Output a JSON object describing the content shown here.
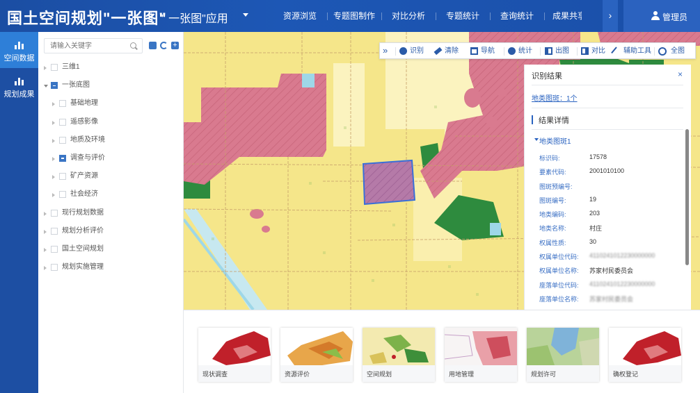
{
  "header": {
    "title": "国土空间规划\"一张图\"",
    "subtitle": "\" 一张图\"应用",
    "nav": [
      "资源浏览",
      "专题图制作",
      "对比分析",
      "专题统计",
      "查询统计",
      "成果共享"
    ],
    "user": "管理员"
  },
  "leftbar": {
    "items": [
      "空间数据",
      "规划成果"
    ]
  },
  "tree": {
    "search_placeholder": "请输入关键字",
    "rows": [
      {
        "label": "三维1",
        "level": 0,
        "state": "none"
      },
      {
        "label": "一张底图",
        "level": 0,
        "state": "partial",
        "open": true
      },
      {
        "label": "基础地理",
        "level": 1,
        "state": "none"
      },
      {
        "label": "遥感影像",
        "level": 1,
        "state": "none"
      },
      {
        "label": "地质及环境",
        "level": 1,
        "state": "none"
      },
      {
        "label": "调查与评价",
        "level": 1,
        "state": "partial"
      },
      {
        "label": "矿产资源",
        "level": 1,
        "state": "none"
      },
      {
        "label": "社会经济",
        "level": 1,
        "state": "none"
      },
      {
        "label": "现行规划数据",
        "level": 0,
        "state": "none"
      },
      {
        "label": "规划分析评价",
        "level": 0,
        "state": "none"
      },
      {
        "label": "国土空间规划",
        "level": 0,
        "state": "none"
      },
      {
        "label": "规划实施管理",
        "level": 0,
        "state": "none"
      }
    ]
  },
  "toolbar": {
    "expand_glyph": "»",
    "items": [
      "识别",
      "清除",
      "导航",
      "统计",
      "出图",
      "对比",
      "辅助工具",
      "全图"
    ]
  },
  "result": {
    "title": "识别结果",
    "close": "×",
    "count_text": "地类图斑：1个",
    "section": "结果详情",
    "group": "地类图斑1",
    "attrs": [
      {
        "k": "标识码:",
        "v": "17578",
        "blur": false
      },
      {
        "k": "要素代码:",
        "v": "2001010100",
        "blur": false
      },
      {
        "k": "图斑预编号:",
        "v": "",
        "blur": false
      },
      {
        "k": "图斑编号:",
        "v": "19",
        "blur": false
      },
      {
        "k": "地类编码:",
        "v": "203",
        "blur": false
      },
      {
        "k": "地类名称:",
        "v": "村庄",
        "blur": false
      },
      {
        "k": "权属性质:",
        "v": "30",
        "blur": false
      },
      {
        "k": "权属单位代码:",
        "v": "4110241012230000000",
        "blur": true
      },
      {
        "k": "权属单位名称:",
        "v": "苏家村民委员会",
        "blur": false
      },
      {
        "k": "座落单位代码:",
        "v": "4110241012230000000",
        "blur": true
      },
      {
        "k": "座落单位名称:",
        "v": "苏家村民委员会",
        "blur": true
      },
      {
        "k": "耕地类型:",
        "v": "",
        "blur": false
      }
    ]
  },
  "thumbnails": [
    "现状调查",
    "资源评价",
    "空间规划",
    "用地管理",
    "规划许可",
    "确权登记"
  ],
  "colors": {
    "header": "#1d57b5",
    "sidebar": "#1d4fa3",
    "sidebar_active": "#2e7fd8",
    "map_base": "#f5e68a",
    "village": "#d97a8f",
    "forest": "#2e8b3e",
    "selection": "#3a6fd8",
    "road": "#9ed7e8"
  }
}
